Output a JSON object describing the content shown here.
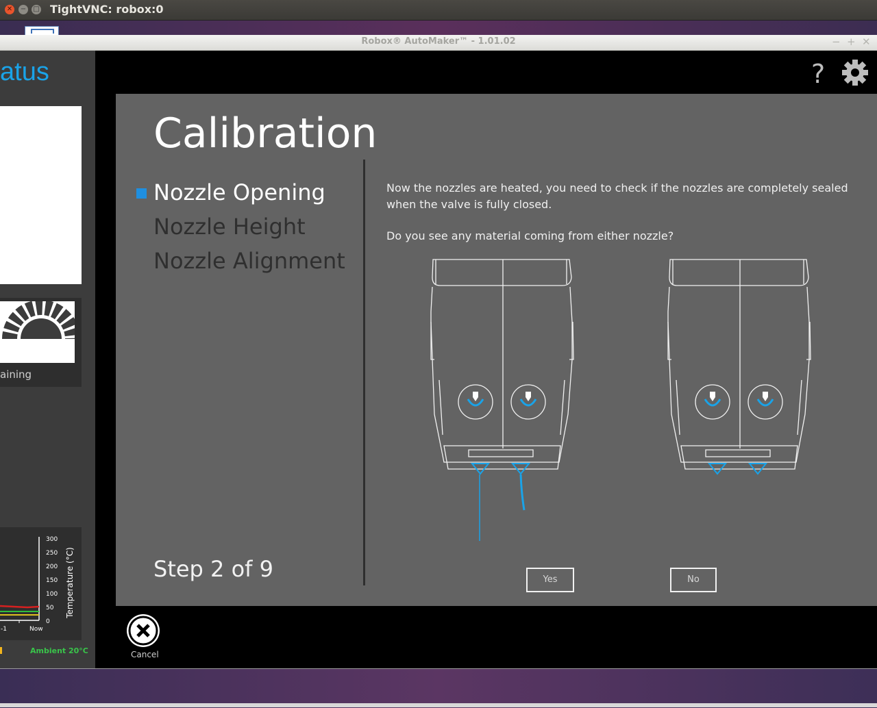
{
  "vnc_window": {
    "title": "TightVNC: robox:0",
    "close_label": "✕",
    "min_label": "−",
    "max_label": "□"
  },
  "app_window": {
    "title": "Robox® AutoMaker™ - 1.01.02",
    "min_label": "−",
    "max_label": "+",
    "close_label": "✕"
  },
  "left_panel": {
    "status_title_partial": "atus",
    "remaining_partial": "aining",
    "ambient_label": "Ambient 20°C",
    "chart": {
      "ylabel": "Temperature (°C)",
      "y_ticks": [
        "300",
        "250",
        "200",
        "150",
        "100",
        "50",
        "0"
      ],
      "x_ticks": [
        "-1",
        "Now"
      ]
    }
  },
  "header": {
    "help_label": "?",
    "help_icon": "help-icon",
    "settings_icon": "gear-icon"
  },
  "calibration": {
    "title": "Calibration",
    "steps": [
      {
        "label": "Nozzle Opening",
        "active": true
      },
      {
        "label": "Nozzle Height",
        "active": false
      },
      {
        "label": "Nozzle Alignment",
        "active": false
      }
    ],
    "step_counter": "Step 2 of 9",
    "instruction": "Now the nozzles are heated, you need to check if the nozzles are completely sealed when the valve is fully closed.",
    "question": "Do you see any material coming from either nozzle?",
    "yes_label": "Yes",
    "no_label": "No",
    "cancel_label": "Cancel",
    "colors": {
      "accent": "#1aa3e8",
      "dialog_bg": "#636363",
      "active_step": "#ffffff",
      "inactive_step": "#2f2f2f"
    }
  }
}
